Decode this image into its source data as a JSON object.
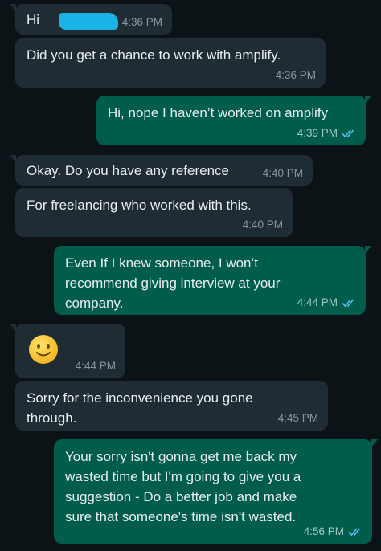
{
  "chat": {
    "messages": [
      {
        "id": "m1",
        "direction": "incoming",
        "text": "Hi ",
        "time": "4:36 PM",
        "redacted_name": true
      },
      {
        "id": "m2",
        "direction": "incoming",
        "text": "Did you get a chance to work with amplify.",
        "time": "4:36 PM"
      },
      {
        "id": "m3",
        "direction": "outgoing",
        "text": "Hi, nope I haven’t worked on amplify",
        "time": "4:39 PM",
        "status": "read"
      },
      {
        "id": "m4",
        "direction": "incoming",
        "text": "Okay. Do you have any reference",
        "time": "4:40 PM"
      },
      {
        "id": "m5",
        "direction": "incoming",
        "text": "For freelancing who worked with this.",
        "time": "4:40 PM"
      },
      {
        "id": "m6",
        "direction": "outgoing",
        "text": "Even If I knew someone, I won’t\nrecommend giving interview at your\ncompany.",
        "time": "4:44 PM",
        "status": "read"
      },
      {
        "id": "m7",
        "direction": "incoming",
        "emoji": "slightly-smiling-face",
        "time": "4:44 PM"
      },
      {
        "id": "m8",
        "direction": "incoming",
        "text": "Sorry for the inconvenience you gone\nthrough.",
        "time": "4:45 PM"
      },
      {
        "id": "m9",
        "direction": "outgoing",
        "text": "Your sorry isn't gonna get me back my\nwasted time but I'm going to give you a\nsuggestion - Do a better job and make\nsure that someone's time isn't wasted.",
        "time": "4:56 PM",
        "status": "read"
      }
    ]
  },
  "colors": {
    "background": "#0c1317",
    "incoming_bubble": "#202c33",
    "outgoing_bubble": "#005c4b",
    "read_tick": "#53bdeb",
    "redaction": "#19b3e6"
  }
}
